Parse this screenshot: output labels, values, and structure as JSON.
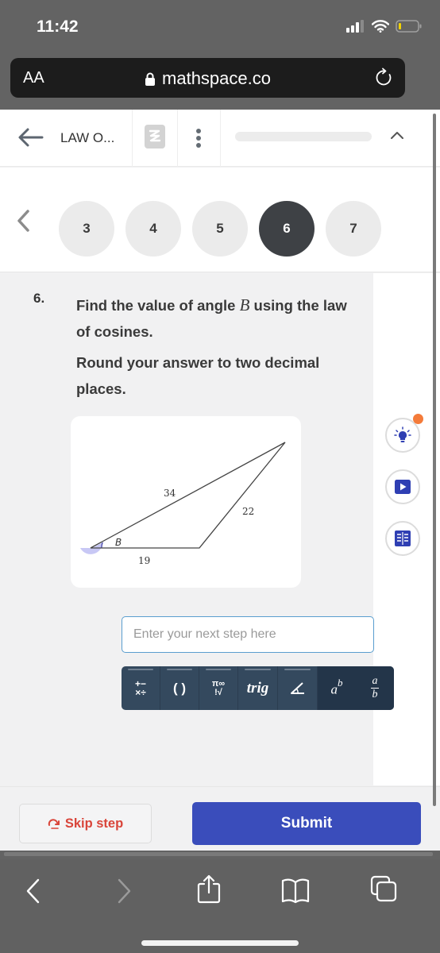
{
  "status_bar": {
    "time": "11:42",
    "signal_icon": "cellular-signal-icon",
    "wifi_icon": "wifi-icon",
    "battery_icon": "battery-low-icon",
    "battery_color": "#f2d300"
  },
  "browser": {
    "text_size_label": "AA",
    "url": "mathspace.co",
    "lock_icon": "lock-icon",
    "reload_icon": "reload-icon"
  },
  "app_header": {
    "back_icon": "arrow-left-icon",
    "breadcrumb": "LAW O...",
    "logo_icon": "mathspace-logo-icon",
    "menu_icon": "kebab-menu-icon",
    "collapse_icon": "chevron-up-icon"
  },
  "steps": {
    "prev_icon": "chevron-left-icon",
    "items": [
      {
        "label": "3",
        "active": false
      },
      {
        "label": "4",
        "active": false
      },
      {
        "label": "5",
        "active": false
      },
      {
        "label": "6",
        "active": true
      },
      {
        "label": "7",
        "active": false
      }
    ]
  },
  "question": {
    "number": "6.",
    "line1_before": "Find the value of angle ",
    "line1_var": "B",
    "line1_after": " using the law of cosines.",
    "line2": "Round your answer to two decimal places."
  },
  "figure": {
    "side_top": "34",
    "side_right": "22",
    "side_bottom": "19",
    "angle_label": "B",
    "angle_fill": "#c8c8f5"
  },
  "side_tools": [
    {
      "icon": "lightbulb-hint-icon",
      "has_notification": true
    },
    {
      "icon": "video-play-icon",
      "has_notification": false
    },
    {
      "icon": "worked-example-book-icon",
      "has_notification": false
    }
  ],
  "answer": {
    "value": "",
    "placeholder": "Enter your next step here"
  },
  "keypad": {
    "keys": [
      {
        "name": "operators",
        "label_top": "+−",
        "label_bottom": "×÷"
      },
      {
        "name": "brackets",
        "label": "( )"
      },
      {
        "name": "symbols",
        "label_top": "π∞",
        "label_bottom": "!√"
      },
      {
        "name": "trig",
        "label": "trig"
      },
      {
        "name": "angle",
        "label": "∠"
      },
      {
        "name": "power",
        "label_base": "a",
        "label_exp": "b"
      },
      {
        "name": "fraction",
        "label_num": "a",
        "label_den": "b"
      }
    ]
  },
  "actions": {
    "skip_label": "Skip step",
    "skip_icon": "skip-arrow-icon",
    "submit_label": "Submit"
  },
  "colors": {
    "accent": "#3a4dbb",
    "keypad": "#34495e",
    "skip": "#d9453a",
    "notification": "#f47b3a",
    "tool_icon": "#2f3fb3"
  },
  "bottom_toolbar": {
    "icons": [
      "back-icon",
      "forward-icon",
      "share-icon",
      "bookmarks-icon",
      "tabs-icon"
    ]
  }
}
